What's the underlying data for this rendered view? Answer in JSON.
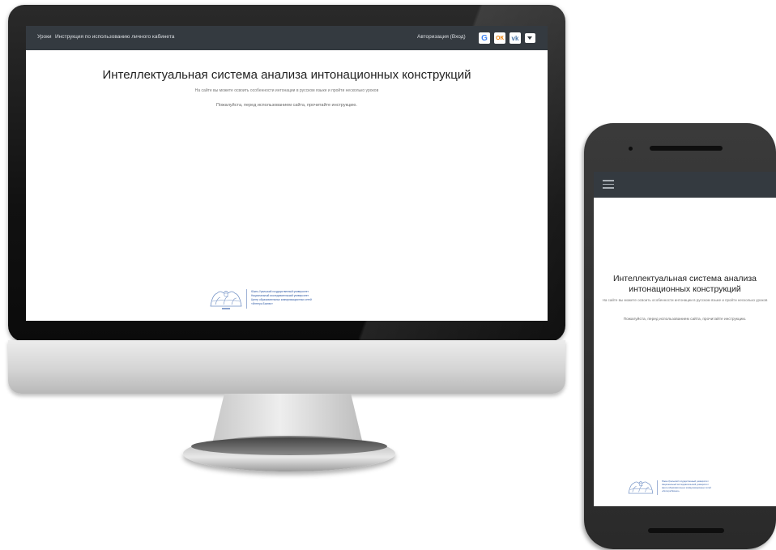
{
  "desktop": {
    "nav": {
      "lessons": "Уроки",
      "instructions": "Инструкция по использованию личного кабинета",
      "login": "Авторизация (Вход)"
    },
    "social": {
      "google_glyph": "G",
      "ok_glyph": "ОК",
      "vk_glyph": "vk"
    },
    "main": {
      "title": "Интеллектуальная система анализа интонационных конструкций",
      "subtitle": "На сайте вы можете освоить особенности интонации в русском языке и пройти несколько уроков",
      "note": "Пожалуйста, перед использованием сайта, прочитайте инструкцию."
    },
    "logo_lines": [
      "Южно-Уральский государственный университет",
      "Национальный исследовательский университет",
      "Центр образовательных коммуникационных сетей",
      "«Интегра Бизнес»"
    ]
  },
  "mobile": {
    "title": "Интеллектуальная система анализа интонационных конструкций",
    "subtitle": "На сайте вы можете освоить особенности интонации в русском языке и пройти несколько уроков",
    "note": "Пожалуйста, перед использованием сайта, прочитайте инструкцию.",
    "logo_lines": [
      "Южно-Уральский государственный университет",
      "Национальный исследовательский университет",
      "Центр образовательных коммуникационных сетей",
      "«Интегра Бизнес»"
    ]
  },
  "colors": {
    "navbar": "#343a40",
    "logo_blue": "#2f5aa6",
    "google": "#4285f4",
    "odnoklassniki": "#ee8208",
    "vk": "#4a76a8"
  },
  "icons": [
    "google-icon",
    "odnoklassniki-icon",
    "vk-icon",
    "dropdown-caret-icon",
    "hamburger-menu-icon",
    "university-emblem-icon"
  ]
}
